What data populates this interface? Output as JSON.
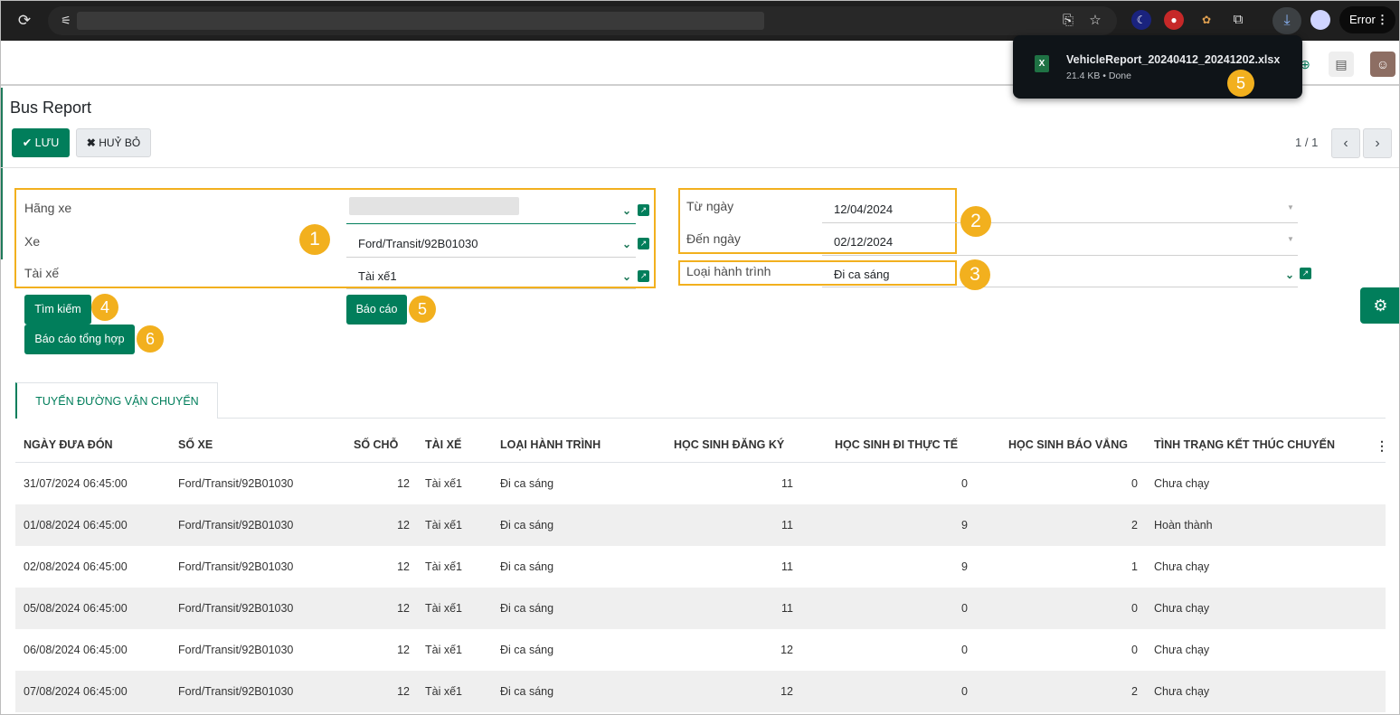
{
  "browser": {
    "extensions": [
      "crescent-icon",
      "pin-icon",
      "cookie-icon",
      "puzzle-icon"
    ],
    "error_label": "Error"
  },
  "download": {
    "filename": "VehicleReport_20240412_20241202.xlsx",
    "meta": "21.4 KB • Done",
    "badge": "5"
  },
  "page": {
    "title": "Bus Report",
    "save_label": "LƯU",
    "cancel_label": "HUỶ BỎ",
    "pager": "1 / 1"
  },
  "form": {
    "left": {
      "badge": "1",
      "fields": [
        {
          "label": "Hãng xe",
          "value": ""
        },
        {
          "label": "Xe",
          "value": "Ford/Transit/92B01030"
        },
        {
          "label": "Tài xế",
          "value": "Tài xế1"
        }
      ]
    },
    "dates": {
      "badge": "2",
      "from_label": "Từ ngày",
      "from_value": "12/04/2024",
      "to_label": "Đến ngày",
      "to_value": "02/12/2024"
    },
    "trip_type": {
      "badge": "3",
      "label": "Loại hành trình",
      "value": "Đi ca sáng"
    }
  },
  "actions": {
    "search_label": "Tìm kiếm",
    "search_badge": "4",
    "report_label": "Báo cáo",
    "report_badge": "5",
    "summary_label": "Báo cáo tổng hợp",
    "summary_badge": "6"
  },
  "tab": {
    "label": "TUYẾN ĐƯỜNG VẬN CHUYỂN"
  },
  "table": {
    "headers": [
      "NGÀY ĐƯA ĐÓN",
      "SỐ XE",
      "SỐ CHỖ",
      "TÀI XẾ",
      "LOẠI HÀNH TRÌNH",
      "HỌC SINH ĐĂNG KÝ",
      "HỌC SINH ĐI THỰC TẾ",
      "HỌC SINH BÁO VẮNG",
      "TÌNH TRẠNG KẾT THÚC CHUYẾN"
    ],
    "rows": [
      [
        "31/07/2024 06:45:00",
        "Ford/Transit/92B01030",
        "12",
        "Tài xế1",
        "Đi ca sáng",
        "11",
        "0",
        "0",
        "Chưa chạy"
      ],
      [
        "01/08/2024 06:45:00",
        "Ford/Transit/92B01030",
        "12",
        "Tài xế1",
        "Đi ca sáng",
        "11",
        "9",
        "2",
        "Hoàn thành"
      ],
      [
        "02/08/2024 06:45:00",
        "Ford/Transit/92B01030",
        "12",
        "Tài xế1",
        "Đi ca sáng",
        "11",
        "9",
        "1",
        "Chưa chạy"
      ],
      [
        "05/08/2024 06:45:00",
        "Ford/Transit/92B01030",
        "12",
        "Tài xế1",
        "Đi ca sáng",
        "11",
        "0",
        "0",
        "Chưa chạy"
      ],
      [
        "06/08/2024 06:45:00",
        "Ford/Transit/92B01030",
        "12",
        "Tài xế1",
        "Đi ca sáng",
        "12",
        "0",
        "0",
        "Chưa chạy"
      ],
      [
        "07/08/2024 06:45:00",
        "Ford/Transit/92B01030",
        "12",
        "Tài xế1",
        "Đi ca sáng",
        "12",
        "0",
        "2",
        "Chưa chạy"
      ]
    ]
  },
  "colors": {
    "primary": "#017e5b",
    "highlight": "#f2b01e"
  }
}
